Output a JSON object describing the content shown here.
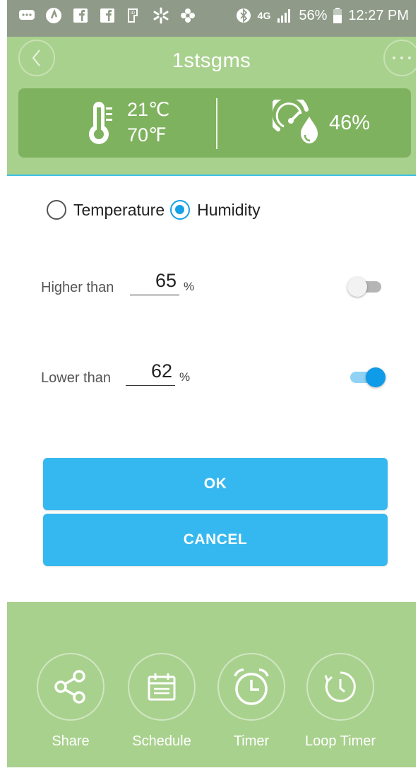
{
  "status_bar": {
    "battery_percent": "56%",
    "time": "12:27 PM",
    "network": "4G"
  },
  "header": {
    "title": "1stsgms",
    "temp_c": "21℃",
    "temp_f": "70℉",
    "humidity": "46%"
  },
  "mode": {
    "options": [
      "Temperature",
      "Humidity"
    ],
    "selected": "Humidity"
  },
  "thresholds": {
    "higher": {
      "label": "Higher than",
      "value": "65",
      "unit": "%",
      "enabled": false
    },
    "lower": {
      "label": "Lower than",
      "value": "62",
      "unit": "%",
      "enabled": true
    }
  },
  "buttons": {
    "ok": "OK",
    "cancel": "CANCEL"
  },
  "toolbar": {
    "items": [
      {
        "label": "Share",
        "icon": "share-icon"
      },
      {
        "label": "Schedule",
        "icon": "calendar-icon"
      },
      {
        "label": "Timer",
        "icon": "alarm-clock-icon"
      },
      {
        "label": "Loop Timer",
        "icon": "loop-timer-icon"
      }
    ]
  },
  "colors": {
    "header_green": "#a9d18e",
    "card_green": "#7fb25f",
    "accent_blue": "#35b8ef",
    "radio_blue": "#14a1e6"
  }
}
